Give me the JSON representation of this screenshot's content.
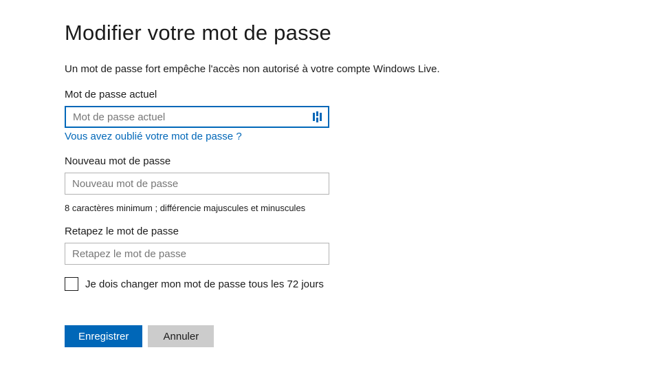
{
  "heading": "Modifier votre mot de passe",
  "description": "Un mot de passe fort empêche l'accès non autorisé à votre compte Windows Live.",
  "fields": {
    "current_password": {
      "label": "Mot de passe actuel",
      "placeholder": "Mot de passe actuel",
      "value": ""
    },
    "new_password": {
      "label": "Nouveau mot de passe",
      "placeholder": "Nouveau mot de passe",
      "value": ""
    },
    "retype_password": {
      "label": "Retapez le mot de passe",
      "placeholder": "Retapez le mot de passe",
      "value": ""
    }
  },
  "forgot_link": "Vous avez oublié votre mot de passe ?",
  "password_hint": "8 caractères minimum ; différencie majuscules et minuscules",
  "checkbox": {
    "label": "Je dois changer mon mot de passe tous les 72 jours",
    "checked": false
  },
  "buttons": {
    "save": "Enregistrer",
    "cancel": "Annuler"
  },
  "colors": {
    "primary": "#0067b8",
    "secondary_button": "#cccccc",
    "text": "#1b1b1b"
  }
}
